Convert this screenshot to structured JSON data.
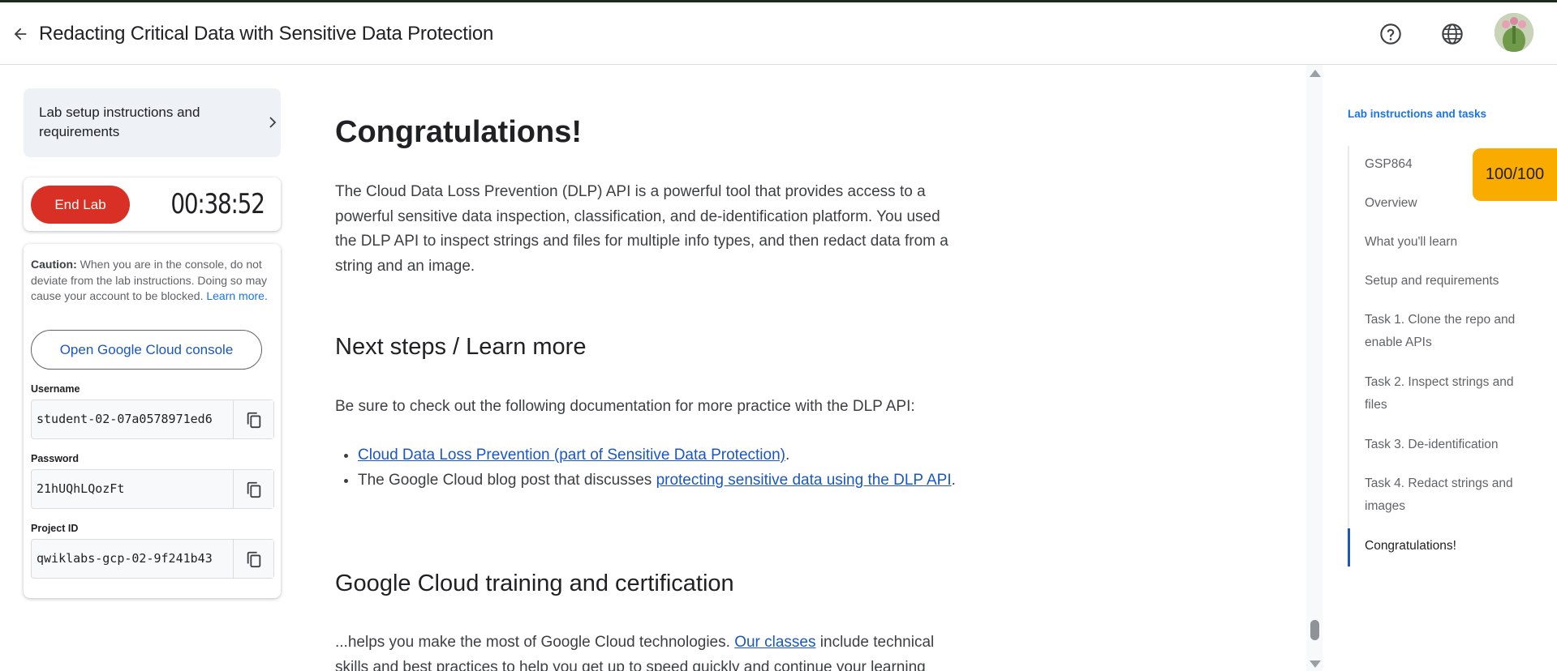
{
  "header": {
    "title": "Redacting Critical Data with Sensitive Data Protection"
  },
  "left_panel": {
    "setup_card_label": "Lab setup instructions and requirements",
    "end_lab_label": "End Lab",
    "timer": "00:38:52",
    "caution_bold": "Caution:",
    "caution_text": " When you are in the console, do not deviate from the lab instructions. Doing so may cause your account to be blocked. ",
    "learn_more": "Learn more.",
    "console_button": "Open Google Cloud console",
    "username_label": "Username",
    "username_value": "student-02-07a0578971ed6",
    "password_label": "Password",
    "password_value": "21hUQhLQozFt",
    "project_label": "Project ID",
    "project_value": "qwiklabs-gcp-02-9f241b43"
  },
  "content": {
    "h1": "Congratulations!",
    "intro": "The Cloud Data Loss Prevention (DLP) API is a powerful tool that provides access to a powerful sensitive data inspection, classification, and de-identification platform. You used the DLP API to inspect strings and files for multiple info types, and then redact data from a string and an image.",
    "h2_next": "Next steps / Learn more",
    "next_intro": "Be sure to check out the following documentation for more practice with the DLP API:",
    "bullet1_link": "Cloud Data Loss Prevention (part of Sensitive Data Protection)",
    "bullet1_after": ".",
    "bullet2_before": "The Google Cloud blog post that discusses ",
    "bullet2_link": "protecting sensitive data using the DLP API",
    "bullet2_after": ".",
    "h2_training": "Google Cloud training and certification",
    "training_before": "...helps you make the most of Google Cloud technologies. ",
    "training_link": "Our classes",
    "training_after": " include technical skills and best practices to help you get up to speed quickly and continue your learning"
  },
  "toc": {
    "title": "Lab instructions and tasks",
    "items": [
      "GSP864",
      "Overview",
      "What you'll learn",
      "Setup and requirements",
      "Task 1. Clone the repo and enable APIs",
      "Task 2. Inspect strings and files",
      "Task 3. De-identification",
      "Task 4. Redact strings and images",
      "Congratulations!"
    ],
    "active_index": 8,
    "score": "100/100"
  },
  "colors": {
    "end_lab": "#d93025",
    "link": "#1a56c4",
    "toc_title": "#1a73e8",
    "score_badge": "#f9ab00"
  },
  "icons": {
    "back": "arrow-back-icon",
    "help": "help-circle-icon",
    "language": "globe-icon",
    "chevron": "chevron-right-icon",
    "copy": "copy-icon"
  }
}
